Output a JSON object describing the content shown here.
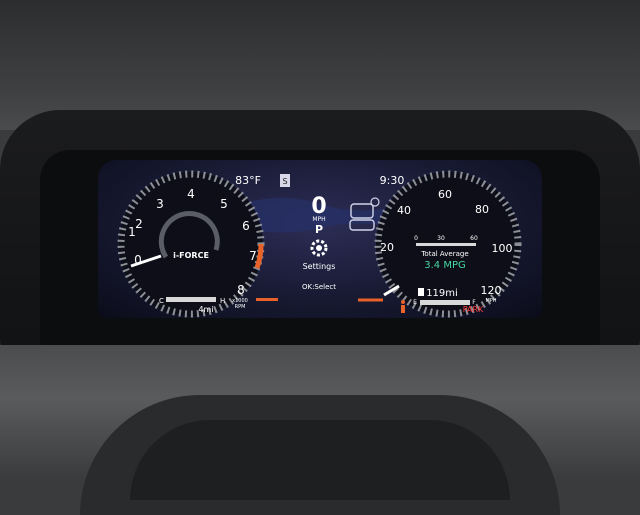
{
  "top_bar": {
    "temperature": "83°F",
    "clock": "9:30",
    "indicator": "S"
  },
  "center": {
    "speed": "0",
    "speed_unit": "MPH",
    "gear": "P",
    "menu_label": "Settings",
    "select_hint": "OK:Select"
  },
  "tachometer": {
    "ticks": [
      "0",
      "1",
      "2",
      "3",
      "4",
      "5",
      "6",
      "7",
      "8"
    ],
    "multiplier": "x1000",
    "unit": "RPM",
    "needle_value": 1,
    "badge": "i-FORCE",
    "temp_low": "C",
    "temp_high": "H",
    "trip": "4mi"
  },
  "speedometer": {
    "ticks": [
      "20",
      "40",
      "60",
      "80",
      "100",
      "120"
    ],
    "unit": "MPH",
    "needle_value": 0,
    "info_title": "Total Average",
    "info_value": "3.4 MPG",
    "scale": [
      "0",
      "30",
      "60"
    ],
    "fuel_low": "E",
    "fuel_high": "F",
    "range": "119mi",
    "park_label": "PARK"
  },
  "colors": {
    "accent_orange": "#e8622a",
    "mpg_green": "#46d6a0",
    "park_red": "#ff3b3b"
  }
}
